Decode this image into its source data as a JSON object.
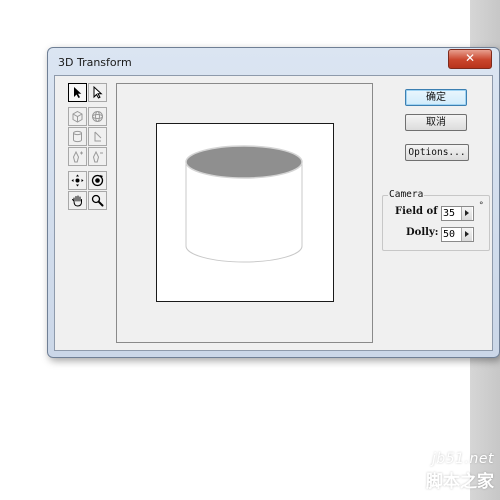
{
  "window": {
    "title": "3D Transform",
    "close_glyph": "✕"
  },
  "buttons": {
    "ok_label": "确定",
    "cancel_label": "取消",
    "options_label": "Options..."
  },
  "camera": {
    "group_label": "Camera",
    "field_of_view_label": "Field of",
    "field_of_view_value": "35",
    "field_of_view_unit": "°",
    "dolly_label": "Dolly:",
    "dolly_value": "50"
  },
  "tools": [
    [
      "selection-arrow-icon",
      "direct-selection-arrow-icon"
    ],
    [
      "cube-icon",
      "sphere-icon"
    ],
    [
      "cylinder-icon",
      "convert-anchor-icon"
    ],
    [
      "add-anchor-icon",
      "delete-anchor-icon"
    ],
    [
      "pan-camera-icon",
      "trackball-icon"
    ],
    [
      "hand-icon",
      "zoom-icon"
    ]
  ],
  "active_tool": "selection-arrow-icon",
  "colors": {
    "title_bar": "#cbd7e8",
    "close_button": "#c9452c",
    "dialog_bg": "#f0f0f0",
    "default_button_border": "#3c7fb1",
    "cylinder_top": "#8f8f8f"
  },
  "watermark": {
    "line1": "jb51.net",
    "line2": "脚本之家"
  }
}
